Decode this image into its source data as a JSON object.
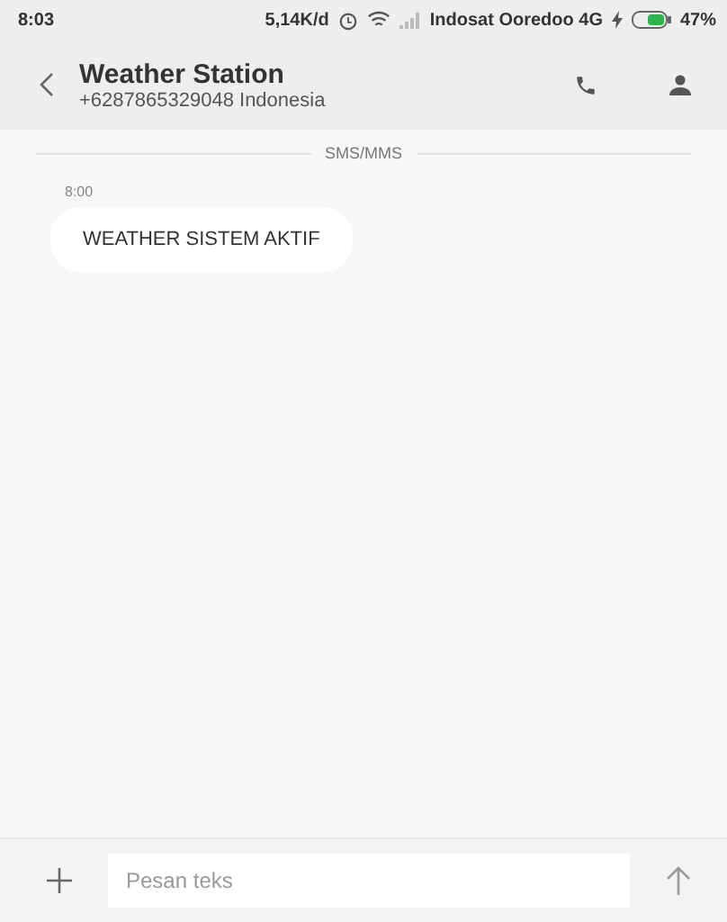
{
  "status_bar": {
    "time": "8:03",
    "speed": "5,14K/d",
    "carrier": "Indosat Ooredoo 4G",
    "battery": "47%"
  },
  "header": {
    "title": "Weather Station",
    "subtitle": "+6287865329048 Indonesia"
  },
  "thread": {
    "channel": "SMS/MMS",
    "messages": [
      {
        "time": "8:00",
        "text": "WEATHER SISTEM AKTIF"
      }
    ]
  },
  "composer": {
    "placeholder": "Pesan teks"
  }
}
